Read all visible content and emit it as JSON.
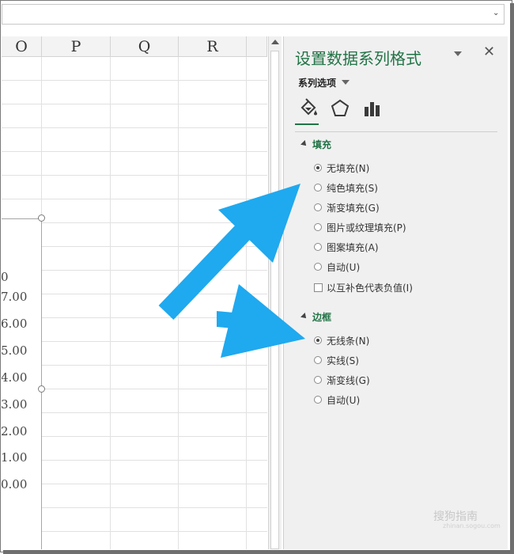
{
  "columns": [
    "O",
    "P",
    "Q",
    "R"
  ],
  "chart": {
    "y_ticks": [
      "0",
      "7.00",
      "6.00",
      "5.00",
      "4.00",
      "3.00",
      "2.00",
      "1.00",
      "0.00"
    ]
  },
  "pane": {
    "title": "设置数据系列格式",
    "series_options_label": "系列选项",
    "tabs": [
      "fill-line-tab",
      "effects-tab",
      "series-options-tab"
    ],
    "fill": {
      "heading": "填充",
      "options": [
        {
          "label": "无填充(N)",
          "selected": true
        },
        {
          "label": "纯色填充(S)",
          "selected": false
        },
        {
          "label": "渐变填充(G)",
          "selected": false
        },
        {
          "label": "图片或纹理填充(P)",
          "selected": false
        },
        {
          "label": "图案填充(A)",
          "selected": false
        },
        {
          "label": "自动(U)",
          "selected": false
        }
      ],
      "invert_label": "以互补色代表负值(I)"
    },
    "border": {
      "heading": "边框",
      "options": [
        {
          "label": "无线条(N)",
          "selected": true
        },
        {
          "label": "实线(S)",
          "selected": false
        },
        {
          "label": "渐变线(G)",
          "selected": false
        },
        {
          "label": "自动(U)",
          "selected": false
        }
      ]
    }
  },
  "colors": {
    "accent": "#217346",
    "arrow": "#1fa9ef"
  },
  "watermark": {
    "text": "搜狗指南",
    "sub": "zhinan.sogou.com"
  }
}
